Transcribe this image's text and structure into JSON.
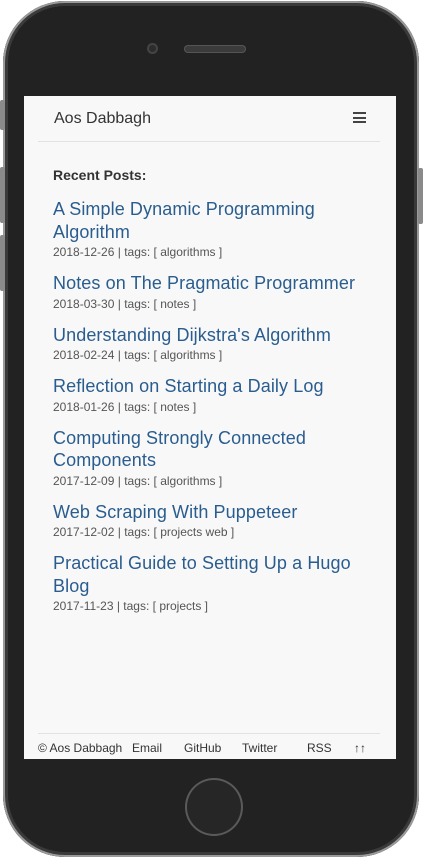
{
  "header": {
    "brand": "Aos Dabbagh",
    "menu_icon": "hamburger-icon"
  },
  "section": {
    "heading": "Recent Posts:"
  },
  "posts": [
    {
      "title": "A Simple Dynamic Programming Algorithm",
      "date": "2018-12-26",
      "tags_label": "tags: [ algorithms ]"
    },
    {
      "title": "Notes on The Pragmatic Programmer",
      "date": "2018-03-30",
      "tags_label": "tags: [ notes ]"
    },
    {
      "title": "Understanding Dijkstra's Algorithm",
      "date": "2018-02-24",
      "tags_label": "tags: [ algorithms ]"
    },
    {
      "title": "Reflection on Starting a Daily Log",
      "date": "2018-01-26",
      "tags_label": "tags: [ notes ]"
    },
    {
      "title": "Computing Strongly Connected Components",
      "date": "2017-12-09",
      "tags_label": "tags: [ algorithms ]"
    },
    {
      "title": "Web Scraping With Puppeteer",
      "date": "2017-12-02",
      "tags_label": "tags: [ projects web ]"
    },
    {
      "title": "Practical Guide to Setting Up a Hugo Blog",
      "date": "2017-11-23",
      "tags_label": "tags: [ projects ]"
    }
  ],
  "footer": {
    "copyright": "© Aos Dabbagh",
    "email": "Email",
    "github": "GitHub",
    "twitter": "Twitter",
    "rss": "RSS",
    "top": "↑↑"
  }
}
